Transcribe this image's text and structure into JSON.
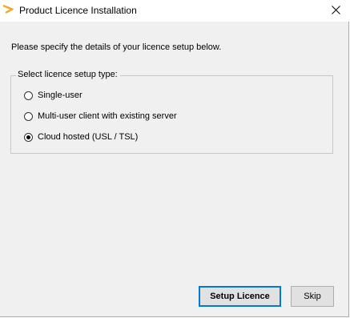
{
  "window": {
    "title": "Product Licence Installation",
    "close_glyph": "✕"
  },
  "main": {
    "intro_text": "Please specify the details of your licence setup below.",
    "group": {
      "legend": "Select licence setup type:",
      "options": [
        {
          "label": "Single-user",
          "selected": false
        },
        {
          "label": "Multi-user client with existing server",
          "selected": false
        },
        {
          "label": "Cloud hosted (USL / TSL)",
          "selected": true
        }
      ]
    }
  },
  "buttons": {
    "setup_label": "Setup Licence",
    "skip_label": "Skip"
  },
  "icons": {
    "app": "app-logo-icon",
    "close": "close-icon"
  },
  "colors": {
    "window_bg": "#f0f0f0",
    "titlebar_bg": "#ffffff",
    "logo_orange": "#f5a623",
    "default_button_border": "#0078d7",
    "button_bg": "#e1e1e1"
  }
}
